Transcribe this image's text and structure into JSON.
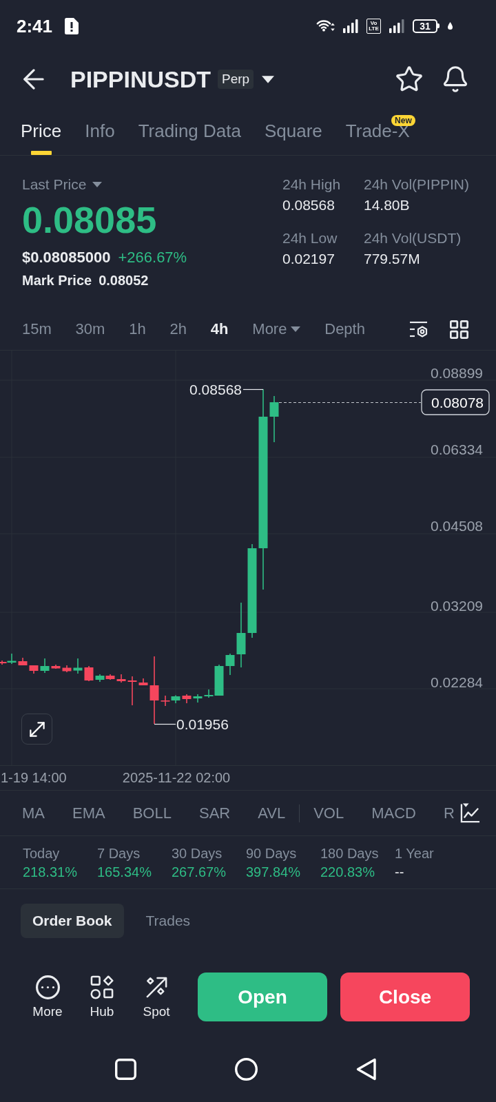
{
  "status_bar": {
    "time": "2:41",
    "network_label": [
      "Vo",
      "LTE"
    ],
    "battery": "31"
  },
  "header": {
    "title": "PIPPINUSDT",
    "badge": "Perp"
  },
  "tabs": [
    {
      "label": "Price",
      "selected": true
    },
    {
      "label": "Info",
      "selected": false
    },
    {
      "label": "Trading Data",
      "selected": false
    },
    {
      "label": "Square",
      "selected": false
    },
    {
      "label": "Trade-X",
      "selected": false,
      "badge": "New"
    }
  ],
  "ticker": {
    "price_label": "Last Price",
    "last_price": "0.08085",
    "usd_price": "$0.08085000",
    "change": "+266.67%",
    "mark_price_label": "Mark Price",
    "mark_price": "0.08052"
  },
  "stats": [
    {
      "label": "24h High",
      "value": "0.08568"
    },
    {
      "label": "24h Vol(PIPPIN)",
      "value": "14.80B"
    },
    {
      "label": "24h Low",
      "value": "0.02197"
    },
    {
      "label": "24h Vol(USDT)",
      "value": "779.57M"
    }
  ],
  "intervals": [
    {
      "label": "15m",
      "selected": false,
      "kind": "option"
    },
    {
      "label": "30m",
      "selected": false,
      "kind": "option"
    },
    {
      "label": "1h",
      "selected": false,
      "kind": "option"
    },
    {
      "label": "2h",
      "selected": false,
      "kind": "option"
    },
    {
      "label": "4h",
      "selected": true,
      "kind": "option"
    },
    {
      "label": "More",
      "selected": false,
      "kind": "menu"
    },
    {
      "label": "Depth",
      "selected": false,
      "kind": "option"
    }
  ],
  "chart": {
    "price_labels": [
      "0.08899",
      "0.06334",
      "0.04508",
      "0.03209",
      "0.02284"
    ],
    "time_labels": [
      "1-19 14:00",
      "2025-11-22 02:00"
    ],
    "high_label": "0.08568",
    "low_label": "0.01956",
    "current_price": "0.08078"
  },
  "indicators": {
    "main": [
      "MA",
      "EMA",
      "BOLL",
      "SAR",
      "AVL"
    ],
    "sub": [
      "VOL",
      "MACD",
      "R"
    ]
  },
  "performance": [
    {
      "label": "Today",
      "value": "218.31%",
      "rising": true
    },
    {
      "label": "7 Days",
      "value": "165.34%",
      "rising": true
    },
    {
      "label": "30 Days",
      "value": "267.67%",
      "rising": true
    },
    {
      "label": "90 Days",
      "value": "397.84%",
      "rising": true
    },
    {
      "label": "180 Days",
      "value": "220.83%",
      "rising": true
    },
    {
      "label": "1 Year",
      "value": "--",
      "rising": false
    }
  ],
  "book_tabs": [
    {
      "label": "Order Book",
      "selected": true
    },
    {
      "label": "Trades",
      "selected": false
    }
  ],
  "actions": [
    {
      "label": "More",
      "kind": "dots"
    },
    {
      "label": "Hub",
      "kind": "shapes"
    },
    {
      "label": "Spot",
      "kind": "arrow"
    }
  ],
  "buttons": [
    {
      "label": "Open",
      "kind": "buy"
    },
    {
      "label": "Close",
      "kind": "sell"
    }
  ]
}
